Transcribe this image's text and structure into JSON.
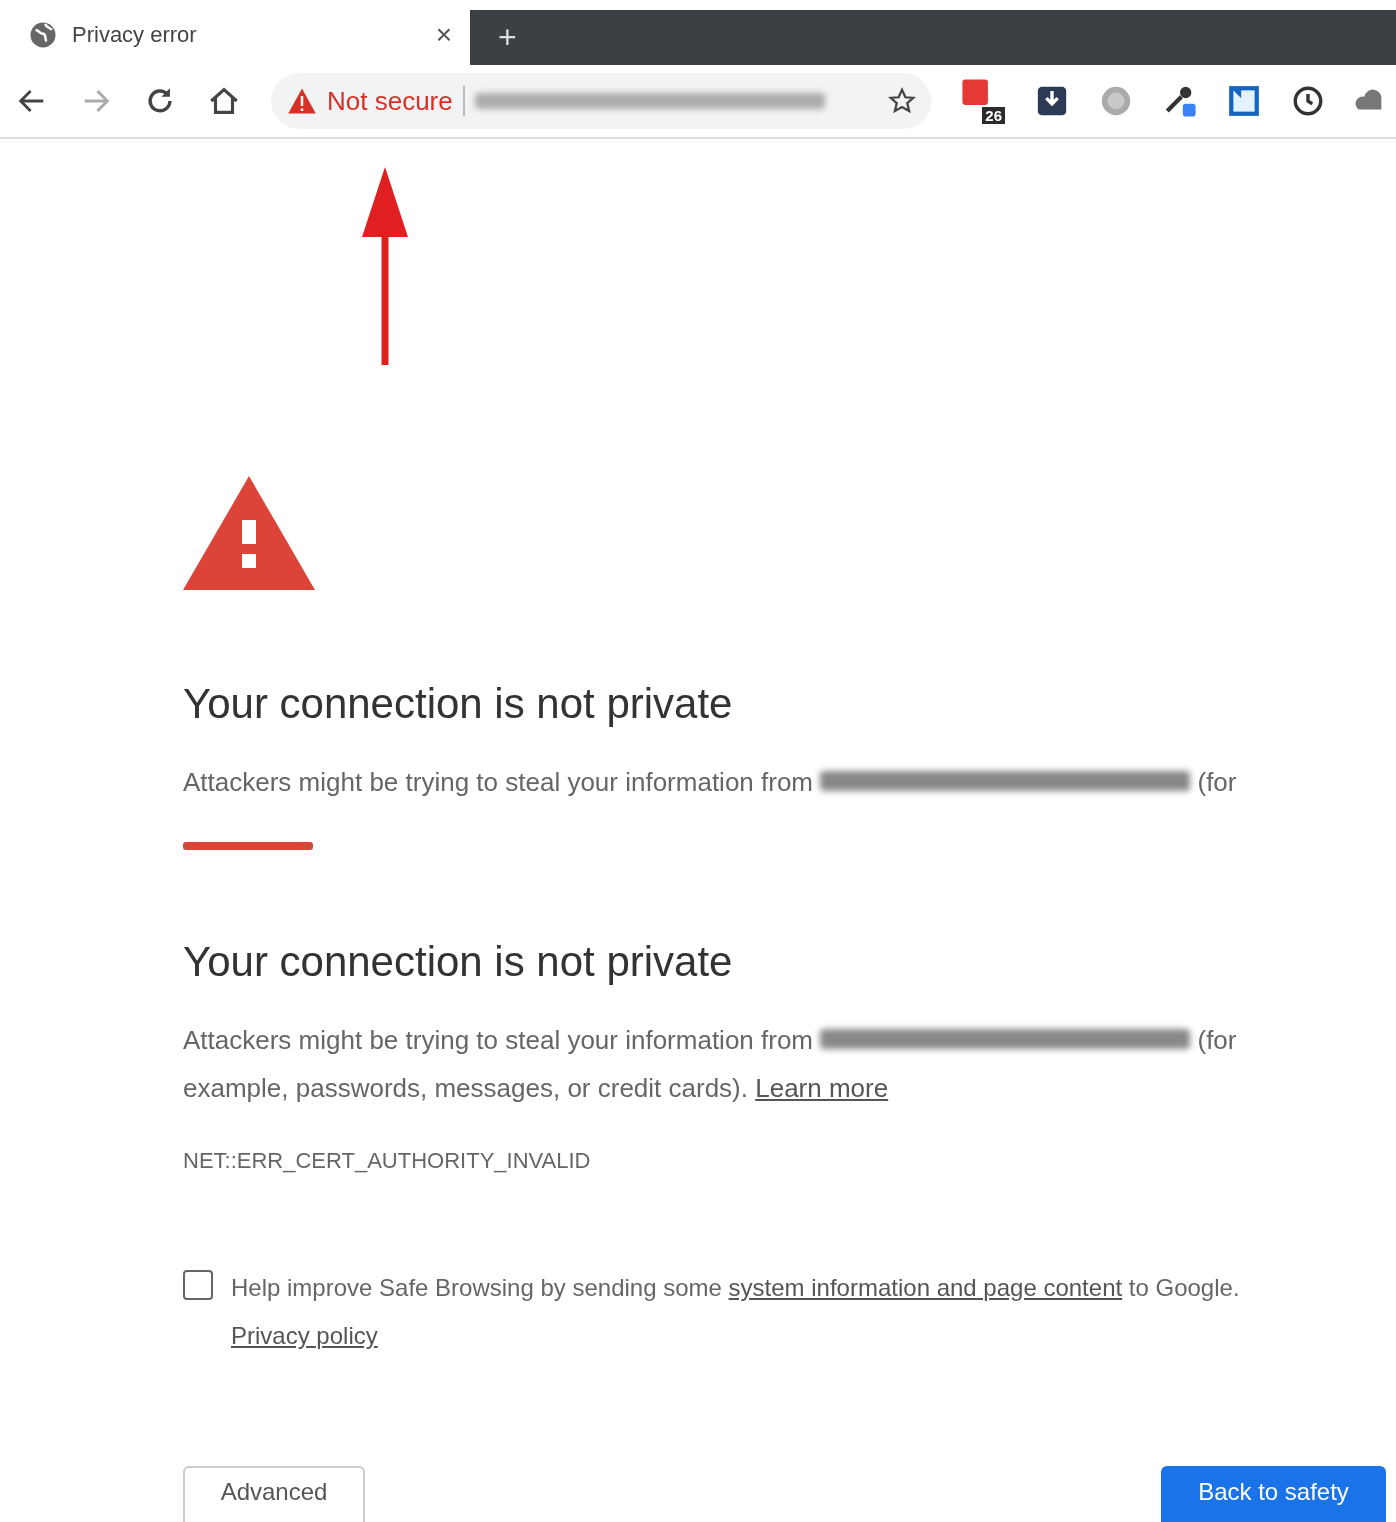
{
  "tab": {
    "title": "Privacy error",
    "close": "×"
  },
  "new_tab": "+",
  "address_bar": {
    "security": "Not secure"
  },
  "extension_badge": "26",
  "first_block": {
    "heading": "Your connection is not private",
    "text": "Attackers might be trying to steal your information from",
    "text_end": "(for"
  },
  "main": {
    "heading": "Your connection is not private",
    "text": "Attackers might be trying to steal your information from",
    "text_end": "(for example, passwords, messages, or credit cards).",
    "learn_more": "Learn more",
    "error_code": "NET::ERR_CERT_AUTHORITY_INVALID"
  },
  "safe_browsing": {
    "checked": false,
    "text": "Help improve Safe Browsing by sending some",
    "link": "system information and page content",
    "text_end": "to Google.",
    "privacy_link": "Privacy policy"
  },
  "buttons": {
    "advanced": "Advanced",
    "back": "Back to safety"
  }
}
